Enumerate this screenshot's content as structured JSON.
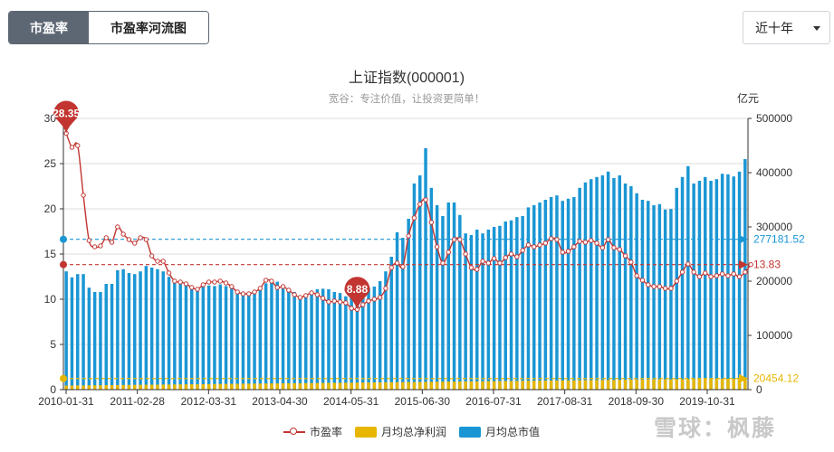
{
  "tabs": [
    {
      "label": "市盈率",
      "active": true
    },
    {
      "label": "市盈率河流图",
      "active": false
    }
  ],
  "period_select": {
    "value": "近十年"
  },
  "watermark": "雪球：枫藤",
  "colors": {
    "pe": "#c23531",
    "profit": "#e6b600",
    "mcap": "#1a96d4"
  },
  "chart_data": {
    "type": "bar",
    "title": "上证指数(000001)",
    "subtitle": "宽谷：专注价值，让投资更简单！",
    "right_axis_unit": "亿元",
    "x_tick_labels": [
      "2010-01-31",
      "2011-02-28",
      "2012-03-31",
      "2013-04-30",
      "2014-05-31",
      "2015-06-30",
      "2016-07-31",
      "2017-08-31",
      "2018-09-30",
      "2019-10-31"
    ],
    "left_axis": {
      "min": 0,
      "max": 30,
      "ticks": [
        0,
        5,
        10,
        15,
        20,
        25,
        30
      ]
    },
    "right_axis": {
      "min": 0,
      "max": 500000,
      "ticks": [
        0,
        100000,
        200000,
        300000,
        400000,
        500000
      ]
    },
    "series": [
      {
        "name": "市盈率",
        "type": "line",
        "axis": "left",
        "values": [
          28.35,
          26.8,
          27,
          21.5,
          16.5,
          15.8,
          15.9,
          16.8,
          16.3,
          18,
          17.2,
          16.6,
          16.2,
          16.8,
          16.6,
          14.8,
          14.2,
          14.2,
          12.9,
          12,
          11.9,
          11.7,
          11.3,
          11.1,
          11.6,
          11.9,
          11.9,
          12,
          11.8,
          11.4,
          10.8,
          10.6,
          10.6,
          10.8,
          11.2,
          12.1,
          12,
          11.3,
          11.4,
          11,
          10.5,
          10.2,
          10.4,
          10.7,
          10.5,
          10.1,
          9.7,
          9.8,
          9.7,
          9.6,
          9,
          8.88,
          9.4,
          9.8,
          10,
          10.2,
          11.2,
          13.5,
          14,
          13.6,
          17,
          19,
          20.5,
          21,
          18.5,
          15.8,
          14,
          15.2,
          16.6,
          16.6,
          15,
          13.5,
          13.3,
          14.2,
          14,
          14.5,
          14,
          14.6,
          15,
          14.7,
          15.4,
          16,
          15.8,
          16,
          16.2,
          16.7,
          16.6,
          15.2,
          15.3,
          15.8,
          16.4,
          16.3,
          16.5,
          16.2,
          15.7,
          16.6,
          15.7,
          15.5,
          14.8,
          14.1,
          12.6,
          12.1,
          11.6,
          11.4,
          11.4,
          11.2,
          11.2,
          12,
          13,
          13.9,
          13,
          12.5,
          12.9,
          12.5,
          12.6,
          12.8,
          12.6,
          12.8,
          12.5,
          13,
          13.83
        ],
        "markers": [
          {
            "type": "max",
            "value": 28.35
          },
          {
            "type": "min",
            "value": 8.88
          }
        ],
        "reference_line": 13.83
      },
      {
        "name": "月均总净利润",
        "type": "bar",
        "axis": "right",
        "start_value": 7500,
        "end_value": 20454.12,
        "reference_line": 20454.12
      },
      {
        "name": "月均总市值",
        "type": "bar",
        "axis": "right",
        "values": [
          218000,
          207000,
          213000,
          213000,
          188000,
          180000,
          180000,
          195000,
          195000,
          220000,
          222000,
          215000,
          213000,
          218000,
          228000,
          225000,
          222000,
          218000,
          208000,
          200000,
          197000,
          193000,
          190000,
          185000,
          190000,
          192000,
          191000,
          194000,
          191000,
          186000,
          180000,
          178000,
          179000,
          182000,
          186000,
          196000,
          203000,
          199000,
          190000,
          185000,
          180000,
          172000,
          177000,
          182000,
          185000,
          186000,
          185000,
          180000,
          178000,
          172000,
          170000,
          176000,
          183000,
          188000,
          190000,
          200000,
          218000,
          245000,
          290000,
          280000,
          315000,
          380000,
          395000,
          445000,
          372000,
          340000,
          320000,
          345000,
          345000,
          322000,
          288000,
          285000,
          295000,
          288000,
          295000,
          300000,
          302000,
          310000,
          312000,
          318000,
          320000,
          336000,
          340000,
          345000,
          350000,
          355000,
          358000,
          348000,
          352000,
          355000,
          372000,
          382000,
          388000,
          392000,
          395000,
          402000,
          390000,
          395000,
          380000,
          375000,
          362000,
          350000,
          348000,
          340000,
          342000,
          332000,
          333000,
          372000,
          392000,
          412000,
          380000,
          385000,
          392000,
          385000,
          388000,
          398000,
          397000,
          393000,
          402000,
          425000
        ],
        "reference_line": 277181.52
      }
    ],
    "reference_labels": {
      "mcap": "277181.52",
      "pe": "13.83",
      "profit": "20454.12"
    },
    "max_label": "28.35",
    "min_label": "8.88",
    "legend_position": "bottom",
    "grid": true
  }
}
